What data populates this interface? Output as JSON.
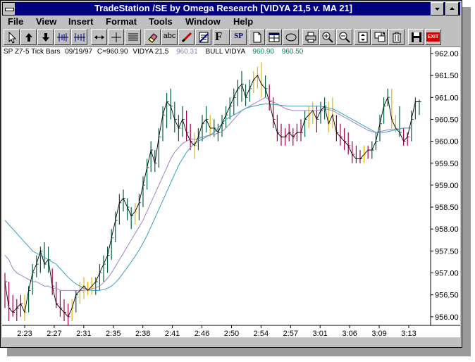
{
  "window": {
    "title": "TradeStation /SE by Omega Research  [VIDYA 21,5 v. MA 21]"
  },
  "menu": [
    {
      "label": "File"
    },
    {
      "label": "View"
    },
    {
      "label": "Insert"
    },
    {
      "label": "Format"
    },
    {
      "label": "Tools"
    },
    {
      "label": "Window"
    },
    {
      "label": "Help"
    }
  ],
  "toolbar": {
    "text_tool": "abc",
    "f_tool": "F",
    "sp_tool": "SP",
    "exit_tool": "EXIT"
  },
  "chart_info": {
    "symbol": "SP Z7-5 Tick Bars",
    "date": "09/19/97",
    "close": "C=960.90",
    "indicator": "VIDYA 21,5",
    "indicator_value": "960.31",
    "bull_label": "BULL VIDYA",
    "bull_value1": "960.90",
    "bull_value2": "960.50"
  },
  "colors": {
    "titlebar": "#000080",
    "up_bar": "#006040",
    "down_bar": "#a0004a",
    "neutral_bar": "#e8b400",
    "vidya_line": "#a080c0",
    "ma_line": "#30a0c0"
  },
  "chart_data": {
    "type": "bar",
    "y_axis": {
      "min": 955.8,
      "max": 962.1,
      "tick_labels": [
        "962.00",
        "961.50",
        "961.00",
        "960.50",
        "960.00",
        "959.50",
        "959.00",
        "958.50",
        "958.00",
        "957.50",
        "957.00",
        "956.50",
        "956.00"
      ]
    },
    "x_axis": {
      "tick_labels": [
        "2:23",
        "2:27",
        "2:31",
        "2:35",
        "2:38",
        "2:41",
        "2:46",
        "2:50",
        "2:54",
        "2:57",
        "3:01",
        "3:06",
        "3:09",
        "3:13"
      ]
    },
    "bars": [
      {
        "h": 957.0,
        "l": 956.2,
        "c": 956.8,
        "t": "d"
      },
      {
        "h": 956.8,
        "l": 955.9,
        "c": 956.2,
        "t": "d"
      },
      {
        "h": 956.5,
        "l": 956.0,
        "c": 956.1,
        "t": "d"
      },
      {
        "h": 956.4,
        "l": 955.9,
        "c": 956.2,
        "t": "d"
      },
      {
        "h": 956.5,
        "l": 956.0,
        "c": 956.3,
        "t": "d"
      },
      {
        "h": 956.5,
        "l": 955.9,
        "c": 956.1,
        "t": "n"
      },
      {
        "h": 956.7,
        "l": 956.1,
        "c": 956.6,
        "t": "u"
      },
      {
        "h": 957.2,
        "l": 956.5,
        "c": 957.0,
        "t": "u"
      },
      {
        "h": 957.4,
        "l": 956.9,
        "c": 957.2,
        "t": "u"
      },
      {
        "h": 957.6,
        "l": 957.0,
        "c": 957.5,
        "t": "u"
      },
      {
        "h": 957.7,
        "l": 957.1,
        "c": 957.2,
        "t": "u"
      },
      {
        "h": 957.6,
        "l": 957.0,
        "c": 957.3,
        "t": "u"
      },
      {
        "h": 957.1,
        "l": 956.5,
        "c": 956.7,
        "t": "d"
      },
      {
        "h": 956.8,
        "l": 956.2,
        "c": 956.3,
        "t": "d"
      },
      {
        "h": 956.6,
        "l": 956.0,
        "c": 956.2,
        "t": "d"
      },
      {
        "h": 956.4,
        "l": 955.9,
        "c": 956.1,
        "t": "d"
      },
      {
        "h": 956.3,
        "l": 955.8,
        "c": 956.0,
        "t": "d"
      },
      {
        "h": 956.4,
        "l": 955.9,
        "c": 956.2,
        "t": "n"
      },
      {
        "h": 956.6,
        "l": 956.1,
        "c": 956.5,
        "t": "u"
      },
      {
        "h": 956.8,
        "l": 956.3,
        "c": 956.6,
        "t": "n"
      },
      {
        "h": 956.9,
        "l": 956.4,
        "c": 956.7,
        "t": "n"
      },
      {
        "h": 956.8,
        "l": 956.5,
        "c": 956.6,
        "t": "n"
      },
      {
        "h": 956.9,
        "l": 956.5,
        "c": 956.7,
        "t": "n"
      },
      {
        "h": 956.9,
        "l": 956.5,
        "c": 956.8,
        "t": "u"
      },
      {
        "h": 957.2,
        "l": 956.6,
        "c": 957.0,
        "t": "u"
      },
      {
        "h": 957.4,
        "l": 956.8,
        "c": 957.2,
        "t": "u"
      },
      {
        "h": 957.6,
        "l": 957.0,
        "c": 957.4,
        "t": "u"
      },
      {
        "h": 958.0,
        "l": 957.3,
        "c": 957.8,
        "t": "u"
      },
      {
        "h": 958.4,
        "l": 957.7,
        "c": 958.2,
        "t": "u"
      },
      {
        "h": 958.8,
        "l": 958.1,
        "c": 958.6,
        "t": "u"
      },
      {
        "h": 958.9,
        "l": 958.4,
        "c": 958.7,
        "t": "u"
      },
      {
        "h": 958.7,
        "l": 958.2,
        "c": 958.5,
        "t": "u"
      },
      {
        "h": 958.5,
        "l": 958.0,
        "c": 958.3,
        "t": "u"
      },
      {
        "h": 958.6,
        "l": 958.1,
        "c": 958.4,
        "t": "n"
      },
      {
        "h": 958.8,
        "l": 958.2,
        "c": 958.6,
        "t": "u"
      },
      {
        "h": 959.2,
        "l": 958.5,
        "c": 959.0,
        "t": "u"
      },
      {
        "h": 959.6,
        "l": 958.9,
        "c": 959.4,
        "t": "u"
      },
      {
        "h": 960.0,
        "l": 959.3,
        "c": 959.8,
        "t": "u"
      },
      {
        "h": 959.8,
        "l": 959.3,
        "c": 959.5,
        "t": "u"
      },
      {
        "h": 960.3,
        "l": 959.4,
        "c": 960.1,
        "t": "u"
      },
      {
        "h": 960.8,
        "l": 960.0,
        "c": 960.6,
        "t": "u"
      },
      {
        "h": 961.1,
        "l": 960.3,
        "c": 960.9,
        "t": "u"
      },
      {
        "h": 961.2,
        "l": 960.5,
        "c": 960.8,
        "t": "u"
      },
      {
        "h": 960.9,
        "l": 960.2,
        "c": 960.5,
        "t": "u"
      },
      {
        "h": 960.6,
        "l": 960.0,
        "c": 960.3,
        "t": "u"
      },
      {
        "h": 960.8,
        "l": 960.1,
        "c": 960.5,
        "t": "u"
      },
      {
        "h": 960.7,
        "l": 960.0,
        "c": 960.2,
        "t": "d"
      },
      {
        "h": 960.4,
        "l": 959.8,
        "c": 960.0,
        "t": "d"
      },
      {
        "h": 960.2,
        "l": 959.6,
        "c": 959.9,
        "t": "n"
      },
      {
        "h": 960.3,
        "l": 959.8,
        "c": 960.1,
        "t": "u"
      },
      {
        "h": 960.6,
        "l": 960.0,
        "c": 960.4,
        "t": "u"
      },
      {
        "h": 960.8,
        "l": 960.2,
        "c": 960.5,
        "t": "u"
      },
      {
        "h": 960.6,
        "l": 960.1,
        "c": 960.3,
        "t": "n"
      },
      {
        "h": 960.5,
        "l": 960.1,
        "c": 960.3,
        "t": "u"
      },
      {
        "h": 960.4,
        "l": 960.0,
        "c": 960.2,
        "t": "u"
      },
      {
        "h": 960.6,
        "l": 960.1,
        "c": 960.4,
        "t": "u"
      },
      {
        "h": 960.8,
        "l": 960.3,
        "c": 960.6,
        "t": "u"
      },
      {
        "h": 961.0,
        "l": 960.5,
        "c": 960.8,
        "t": "u"
      },
      {
        "h": 961.2,
        "l": 960.6,
        "c": 961.0,
        "t": "u"
      },
      {
        "h": 961.4,
        "l": 960.8,
        "c": 961.2,
        "t": "u"
      },
      {
        "h": 961.6,
        "l": 960.9,
        "c": 961.3,
        "t": "u"
      },
      {
        "h": 961.3,
        "l": 960.8,
        "c": 961.0,
        "t": "u"
      },
      {
        "h": 961.4,
        "l": 960.9,
        "c": 961.2,
        "t": "u"
      },
      {
        "h": 961.6,
        "l": 961.1,
        "c": 961.4,
        "t": "n"
      },
      {
        "h": 961.7,
        "l": 961.2,
        "c": 961.5,
        "t": "n"
      },
      {
        "h": 961.8,
        "l": 961.0,
        "c": 961.3,
        "t": "n"
      },
      {
        "h": 961.5,
        "l": 961.0,
        "c": 961.2,
        "t": "u"
      },
      {
        "h": 961.3,
        "l": 960.7,
        "c": 960.9,
        "t": "d"
      },
      {
        "h": 961.0,
        "l": 960.3,
        "c": 960.5,
        "t": "d"
      },
      {
        "h": 960.6,
        "l": 960.0,
        "c": 960.2,
        "t": "d"
      },
      {
        "h": 960.4,
        "l": 959.9,
        "c": 960.1,
        "t": "d"
      },
      {
        "h": 960.3,
        "l": 959.9,
        "c": 960.1,
        "t": "d"
      },
      {
        "h": 960.4,
        "l": 960.0,
        "c": 960.2,
        "t": "d"
      },
      {
        "h": 960.3,
        "l": 959.9,
        "c": 960.1,
        "t": "d"
      },
      {
        "h": 960.4,
        "l": 960.0,
        "c": 960.2,
        "t": "d"
      },
      {
        "h": 960.5,
        "l": 960.0,
        "c": 960.2,
        "t": "d"
      },
      {
        "h": 960.7,
        "l": 960.1,
        "c": 960.5,
        "t": "u"
      },
      {
        "h": 960.8,
        "l": 960.3,
        "c": 960.6,
        "t": "n"
      },
      {
        "h": 960.9,
        "l": 960.4,
        "c": 960.7,
        "t": "n"
      },
      {
        "h": 960.8,
        "l": 960.2,
        "c": 960.5,
        "t": "d"
      },
      {
        "h": 960.9,
        "l": 960.4,
        "c": 960.7,
        "t": "u"
      },
      {
        "h": 961.0,
        "l": 960.5,
        "c": 960.8,
        "t": "u"
      },
      {
        "h": 960.9,
        "l": 960.2,
        "c": 960.4,
        "t": "n"
      },
      {
        "h": 961.0,
        "l": 960.3,
        "c": 960.6,
        "t": "n"
      },
      {
        "h": 960.6,
        "l": 960.0,
        "c": 960.2,
        "t": "d"
      },
      {
        "h": 960.4,
        "l": 959.9,
        "c": 960.1,
        "t": "d"
      },
      {
        "h": 960.3,
        "l": 959.8,
        "c": 960.0,
        "t": "d"
      },
      {
        "h": 960.2,
        "l": 959.7,
        "c": 959.9,
        "t": "d"
      },
      {
        "h": 960.0,
        "l": 959.5,
        "c": 959.7,
        "t": "d"
      },
      {
        "h": 959.9,
        "l": 959.5,
        "c": 959.6,
        "t": "d"
      },
      {
        "h": 959.8,
        "l": 959.5,
        "c": 959.6,
        "t": "d"
      },
      {
        "h": 959.9,
        "l": 959.5,
        "c": 959.7,
        "t": "n"
      },
      {
        "h": 959.9,
        "l": 959.6,
        "c": 959.8,
        "t": "d"
      },
      {
        "h": 960.0,
        "l": 959.6,
        "c": 959.8,
        "t": "u"
      },
      {
        "h": 960.2,
        "l": 959.8,
        "c": 960.0,
        "t": "u"
      },
      {
        "h": 960.6,
        "l": 960.0,
        "c": 960.4,
        "t": "u"
      },
      {
        "h": 961.0,
        "l": 960.4,
        "c": 960.8,
        "t": "u"
      },
      {
        "h": 961.2,
        "l": 960.8,
        "c": 961.0,
        "t": "u"
      },
      {
        "h": 961.2,
        "l": 960.3,
        "c": 960.5,
        "t": "n"
      },
      {
        "h": 960.6,
        "l": 960.2,
        "c": 960.3,
        "t": "n"
      },
      {
        "h": 960.8,
        "l": 960.1,
        "c": 960.2,
        "t": "u"
      },
      {
        "h": 960.3,
        "l": 959.9,
        "c": 960.0,
        "t": "d"
      },
      {
        "h": 960.2,
        "l": 959.9,
        "c": 960.1,
        "t": "d"
      },
      {
        "h": 960.7,
        "l": 960.0,
        "c": 960.5,
        "t": "u"
      },
      {
        "h": 961.0,
        "l": 960.5,
        "c": 960.9,
        "t": "u"
      },
      {
        "h": 960.95,
        "l": 960.6,
        "c": 960.9,
        "t": "u"
      }
    ],
    "vidya": [
      957.4,
      957.3,
      957.1,
      957.0,
      956.95,
      956.9,
      956.85,
      956.8,
      956.8,
      956.75,
      956.7,
      956.7,
      956.65,
      956.65,
      956.6,
      956.6,
      956.6,
      956.6,
      956.6,
      956.6,
      956.6,
      956.62,
      956.64,
      956.66,
      956.7,
      956.78,
      956.88,
      957.0,
      957.15,
      957.3,
      957.45,
      957.6,
      957.75,
      957.9,
      958.05,
      958.2,
      958.4,
      958.6,
      958.8,
      959.0,
      959.2,
      959.4,
      959.6,
      959.75,
      959.85,
      959.95,
      960.0,
      960.05,
      960.05,
      960.05,
      960.1,
      960.12,
      960.14,
      960.16,
      960.18,
      960.22,
      960.3,
      960.4,
      960.5,
      960.6,
      960.7,
      960.75,
      960.8,
      960.85,
      960.9,
      960.95,
      961.0,
      960.95,
      960.9,
      960.85,
      960.8,
      960.75,
      960.72,
      960.7,
      960.7,
      960.7,
      960.7,
      960.7,
      960.7,
      960.7,
      960.72,
      960.74,
      960.72,
      960.7,
      960.65,
      960.6,
      960.55,
      960.5,
      960.45,
      960.4,
      960.35,
      960.3,
      960.25,
      960.22,
      960.2,
      960.22,
      960.24,
      960.26,
      960.28,
      960.28,
      960.28,
      960.3,
      960.3,
      960.3
    ],
    "ma": [
      958.2,
      958.1,
      958.0,
      957.9,
      957.8,
      957.7,
      957.6,
      957.5,
      957.45,
      957.4,
      957.35,
      957.3,
      957.25,
      957.2,
      957.1,
      957.0,
      956.9,
      956.82,
      956.75,
      956.7,
      956.65,
      956.62,
      956.6,
      956.6,
      956.6,
      956.62,
      956.65,
      956.7,
      956.78,
      956.88,
      957.0,
      957.12,
      957.25,
      957.38,
      957.52,
      957.68,
      957.85,
      958.05,
      958.25,
      958.45,
      958.65,
      958.85,
      959.05,
      959.25,
      959.45,
      959.6,
      959.75,
      959.85,
      959.95,
      960.0,
      960.05,
      960.1,
      960.15,
      960.2,
      960.3,
      960.4,
      960.5,
      960.55,
      960.6,
      960.65,
      960.7,
      960.75,
      960.78,
      960.8,
      960.82,
      960.84,
      960.85,
      960.85,
      960.84,
      960.83,
      960.82,
      960.81,
      960.8,
      960.8,
      960.8,
      960.8,
      960.8,
      960.8,
      960.8,
      960.8,
      960.8,
      960.78,
      960.76,
      960.74,
      960.7,
      960.65,
      960.6,
      960.55,
      960.5,
      960.45,
      960.4,
      960.35,
      960.3,
      960.25,
      960.2,
      960.2,
      960.2,
      960.22,
      960.24,
      960.26,
      960.28,
      960.3,
      960.3,
      960.3
    ]
  }
}
